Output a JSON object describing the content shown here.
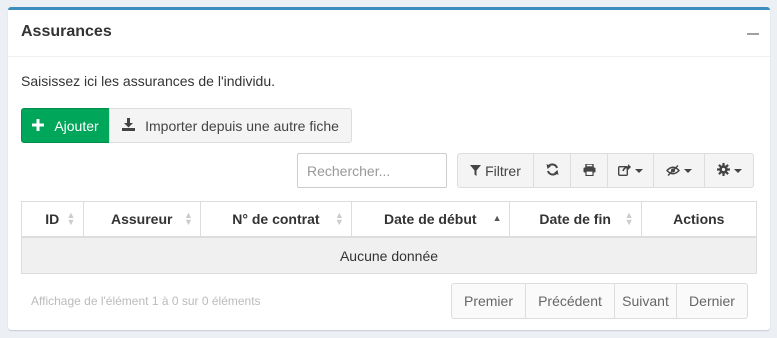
{
  "box": {
    "title": "Assurances",
    "intro": "Saisissez ici les assurances de l'individu."
  },
  "actions": {
    "add_label": "Ajouter",
    "import_label": "Importer depuis une autre fiche"
  },
  "search": {
    "placeholder": "Rechercher..."
  },
  "toolbar": {
    "filter_label": "Filtrer",
    "icons": [
      "filter-icon",
      "refresh-icon",
      "print-icon",
      "export-icon",
      "columns-visibility-icon",
      "settings-icon"
    ]
  },
  "table": {
    "columns": [
      "ID",
      "Assureur",
      "N° de contrat",
      "Date de début",
      "Date de fin",
      "Actions"
    ],
    "empty_message": "Aucune donnée",
    "sorted_column": "Date de début",
    "sort_direction": "ascending"
  },
  "footer": {
    "info": "Affichage de l'élément 1 à 0 sur 0 éléments",
    "pagination": [
      "Premier",
      "Précédent",
      "Suivant",
      "Dernier"
    ]
  },
  "colors": {
    "accent": "#3c8dbc",
    "success": "#00a65a"
  }
}
